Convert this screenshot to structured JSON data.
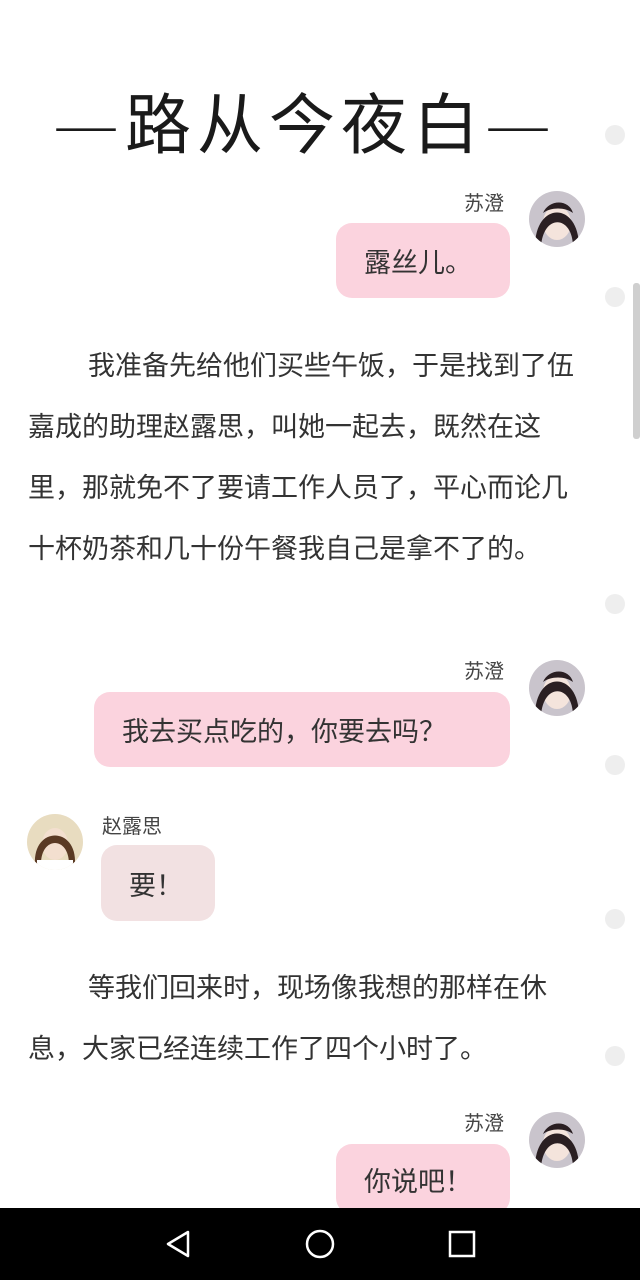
{
  "title": "—路从今夜白—",
  "messages": [
    {
      "speaker": "苏澄",
      "text": "露丝儿。"
    },
    {
      "speaker": "苏澄",
      "text": "我去买点吃的，你要去吗？"
    },
    {
      "speaker": "赵露思",
      "text": "要！"
    },
    {
      "speaker": "苏澄",
      "text": "你说吧！"
    }
  ],
  "paragraphs": [
    "我准备先给他们买些午饭，于是找到了伍嘉成的助理赵露思，叫她一起去，既然在这里，那就免不了要请工作人员了，平心而论几十杯奶茶和几十份午餐我自己是拿不了的。",
    "等我们回来时，现场像我想的那样在休息，大家已经连续工作了四个小时了。"
  ],
  "colors": {
    "bubble_pink": "#fbd3de",
    "bubble_beige": "#f2e1e2"
  },
  "navbar": {
    "back_icon": "triangle-back-icon",
    "home_icon": "circle-home-icon",
    "recents_icon": "square-recents-icon"
  }
}
